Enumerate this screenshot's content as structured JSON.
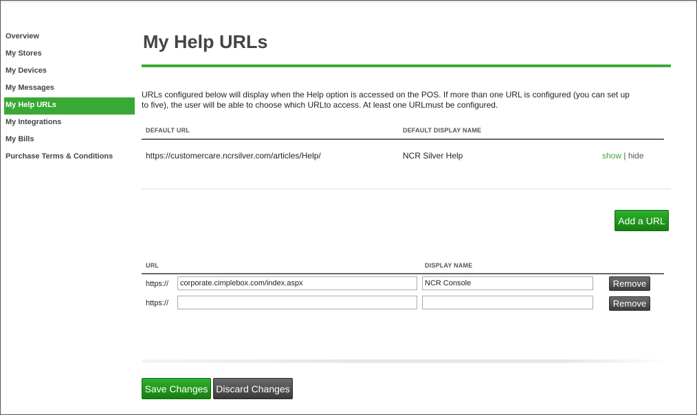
{
  "sidebar": {
    "items": [
      {
        "label": "Overview",
        "active": false
      },
      {
        "label": "My Stores",
        "active": false
      },
      {
        "label": "My Devices",
        "active": false
      },
      {
        "label": "My Messages",
        "active": false
      },
      {
        "label": "My Help URLs",
        "active": true
      },
      {
        "label": "My Integrations",
        "active": false
      },
      {
        "label": "My Bills",
        "active": false
      },
      {
        "label": "Purchase Terms & Conditions",
        "active": false
      }
    ]
  },
  "page": {
    "title": "My Help URLs",
    "intro": "URLs configured below will display when the Help option is accessed on the POS. If more than one URL is configured (you can set up to five), the user will be able to choose which URLto access. At least one URLmust be configured."
  },
  "default_table": {
    "headers": {
      "url": "DEFAULT URL",
      "display_name": "DEFAULT DISPLAY NAME"
    },
    "row": {
      "url": "https://customercare.ncrsilver.com/articles/Help/",
      "display_name": "NCR Silver Help",
      "show_label": "show",
      "separator": "|",
      "hide_label": "hide"
    }
  },
  "add_url_button": "Add a URL",
  "url_table": {
    "headers": {
      "url": "URL",
      "display_name": "DISPLAY NAME"
    },
    "rows": [
      {
        "prefix": "https://",
        "url_value": "corporate.cimplebox.com/index.aspx",
        "name_value": "NCR Console",
        "remove_label": "Remove"
      },
      {
        "prefix": "https://",
        "url_value": "",
        "name_value": "",
        "remove_label": "Remove"
      }
    ]
  },
  "actions": {
    "save_label": "Save Changes",
    "discard_label": "Discard Changes"
  },
  "colors": {
    "accent_green": "#39a935",
    "button_green": "#1f9a1c",
    "button_dark": "#4a4a4a"
  }
}
